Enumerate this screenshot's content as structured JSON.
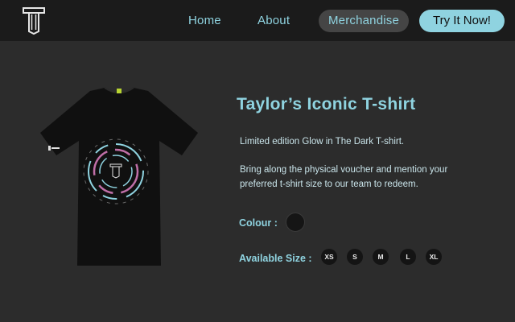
{
  "nav": {
    "home": "Home",
    "about": "About",
    "merchandise": "Merchandise",
    "cta": "Try It Now!",
    "accent_color": "#8fd3e0"
  },
  "product": {
    "title": "Taylor’s Iconic T-shirt",
    "description_1": "Limited edition Glow in The Dark T-shirt.",
    "description_2": "Bring along the physical voucher and mention your preferred t-shirt size to our team to redeem.",
    "colour_label": "Colour :",
    "size_label": "Available Size :",
    "colour_options": [
      "#151515"
    ],
    "sizes": [
      "XS",
      "S",
      "M",
      "L",
      "XL"
    ]
  }
}
